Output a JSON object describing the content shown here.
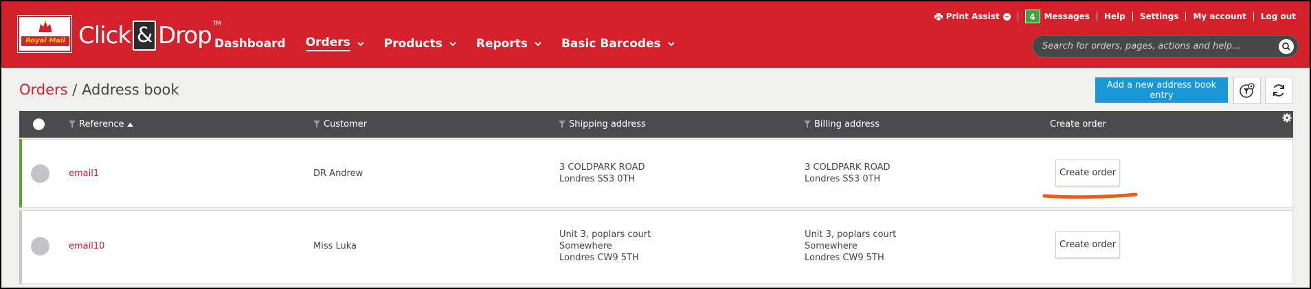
{
  "brand": {
    "logo_text": "Royal Mail",
    "name_part1": "Click",
    "amp": "&",
    "name_part2": "Drop",
    "tm": "TM"
  },
  "nav": [
    {
      "label": "Dashboard",
      "has_menu": false,
      "active": false
    },
    {
      "label": "Orders",
      "has_menu": true,
      "active": true
    },
    {
      "label": "Products",
      "has_menu": true,
      "active": false
    },
    {
      "label": "Reports",
      "has_menu": true,
      "active": false
    },
    {
      "label": "Basic Barcodes",
      "has_menu": true,
      "active": false
    }
  ],
  "toplinks": {
    "print_assist": "Print Assist",
    "messages_count": "4",
    "messages": "Messages",
    "help": "Help",
    "settings": "Settings",
    "my_account": "My account",
    "log_out": "Log out"
  },
  "search": {
    "placeholder": "Search for orders, pages, actions and help..."
  },
  "breadcrumb": {
    "root": "Orders",
    "separator": " / ",
    "current": "Address book"
  },
  "actions": {
    "add_entry": "Add a new address book entry"
  },
  "table": {
    "columns": {
      "reference": "Reference",
      "customer": "Customer",
      "shipping": "Shipping address",
      "billing": "Billing address",
      "create_order": "Create order"
    },
    "rows": [
      {
        "reference": "email1",
        "customer": "DR Andrew",
        "shipping": [
          "3 COLDPARK ROAD",
          "Londres SS3 0TH"
        ],
        "billing": [
          "3 COLDPARK ROAD",
          "Londres SS3 0TH"
        ],
        "button": "Create order"
      },
      {
        "reference": "email10",
        "customer": "Miss Luka",
        "shipping": [
          "Unit 3, poplars court",
          "Somewhere",
          "Londres CW9 5TH"
        ],
        "billing": [
          "Unit 3, poplars court",
          "Somewhere",
          "Londres CW9 5TH"
        ],
        "button": "Create order"
      }
    ]
  },
  "colors": {
    "brand_red": "#d4202a",
    "primary_blue": "#1897d4",
    "selected_green": "#58a431",
    "annotation_orange": "#f05a14"
  }
}
